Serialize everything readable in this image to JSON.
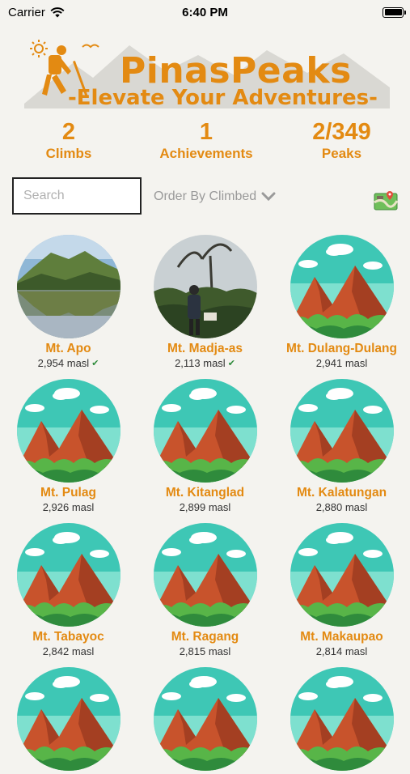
{
  "status_bar": {
    "carrier": "Carrier",
    "time": "6:40 PM"
  },
  "logo": {
    "title": "PinasPeaks",
    "tagline": "-Elevate Your Adventures-"
  },
  "stats": [
    {
      "value": "2",
      "label": "Climbs"
    },
    {
      "value": "1",
      "label": "Achievements"
    },
    {
      "value": "2/349",
      "label": "Peaks"
    }
  ],
  "controls": {
    "search_placeholder": "Search",
    "order_label": "Order By Climbed"
  },
  "peaks": [
    {
      "name": "Mt. Apo",
      "elevation": "2,954 masl",
      "climbed": true,
      "image": "lake-photo"
    },
    {
      "name": "Mt. Madja-as",
      "elevation": "2,113 masl",
      "climbed": true,
      "image": "hiker-photo"
    },
    {
      "name": "Mt. Dulang-Dulang",
      "elevation": "2,941 masl",
      "climbed": false,
      "image": "mountain-illustration"
    },
    {
      "name": "Mt. Pulag",
      "elevation": "2,926 masl",
      "climbed": false,
      "image": "mountain-illustration"
    },
    {
      "name": "Mt. Kitanglad",
      "elevation": "2,899 masl",
      "climbed": false,
      "image": "mountain-illustration"
    },
    {
      "name": "Mt. Kalatungan",
      "elevation": "2,880 masl",
      "climbed": false,
      "image": "mountain-illustration"
    },
    {
      "name": "Mt. Tabayoc",
      "elevation": "2,842 masl",
      "climbed": false,
      "image": "mountain-illustration"
    },
    {
      "name": "Mt. Ragang",
      "elevation": "2,815 masl",
      "climbed": false,
      "image": "mountain-illustration"
    },
    {
      "name": "Mt. Makaupao",
      "elevation": "2,814 masl",
      "climbed": false,
      "image": "mountain-illustration"
    },
    {
      "name": "",
      "elevation": "",
      "climbed": false,
      "image": "mountain-illustration"
    },
    {
      "name": "",
      "elevation": "",
      "climbed": false,
      "image": "mountain-illustration"
    },
    {
      "name": "",
      "elevation": "",
      "climbed": false,
      "image": "mountain-illustration"
    }
  ],
  "colors": {
    "accent": "#e38a12",
    "background": "#f4f3ef",
    "check": "#2e8b3c"
  }
}
